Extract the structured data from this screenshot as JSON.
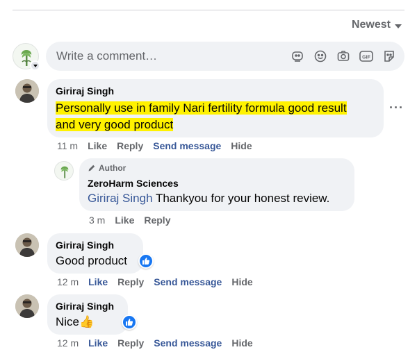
{
  "sort": {
    "label": "Newest"
  },
  "composer": {
    "placeholder": "Write a comment…"
  },
  "actions": {
    "like": "Like",
    "reply": "Reply",
    "send": "Send message",
    "hide": "Hide"
  },
  "comments": [
    {
      "author": "Giriraj Singh",
      "line1": "Personally use in family Nari fertility formula good result",
      "line2": "and very good product",
      "time": "11 m",
      "highlighted": true
    },
    {
      "author": "Giriraj Singh",
      "text": "Good product",
      "time": "12 m"
    },
    {
      "author": "Giriraj Singh",
      "text": "Nice",
      "emoji": "👍",
      "time": "12 m"
    }
  ],
  "reply": {
    "badge": "Author",
    "author": "ZeroHarm Sciences",
    "mention": "Giriraj Singh",
    "text": " Thankyou for your honest review.",
    "time": "3 m"
  },
  "colors": {
    "highlight": "#fff200",
    "link": "#385898",
    "bubble": "#f0f2f5",
    "like_blue": "#1877f2"
  },
  "icons": [
    "sticker-icon",
    "emoji-icon",
    "camera-icon",
    "gif-icon",
    "avatar-sticker-icon",
    "more-icon",
    "pencil-icon",
    "like-icon"
  ]
}
